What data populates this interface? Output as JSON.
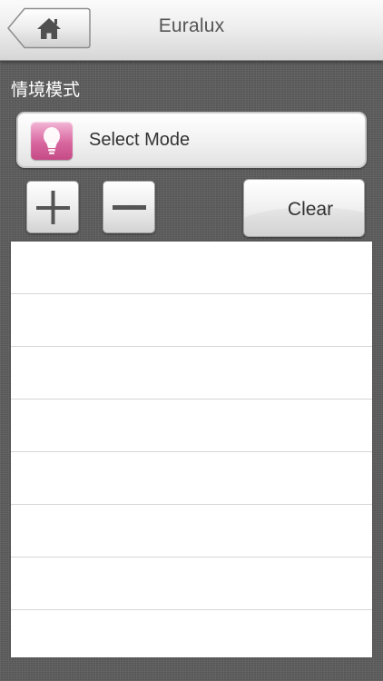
{
  "navbar": {
    "title": "Euralux",
    "home_icon": "home-icon"
  },
  "section": {
    "label": "情境模式"
  },
  "mode_selector": {
    "label": "Select Mode",
    "icon": "lightbulb-icon",
    "icon_color": "#d9679f"
  },
  "toolbar": {
    "add_icon": "plus-icon",
    "remove_icon": "minus-icon",
    "clear_label": "Clear"
  },
  "list": {
    "rows": [
      "",
      "",
      "",
      "",
      "",
      "",
      "",
      ""
    ]
  }
}
